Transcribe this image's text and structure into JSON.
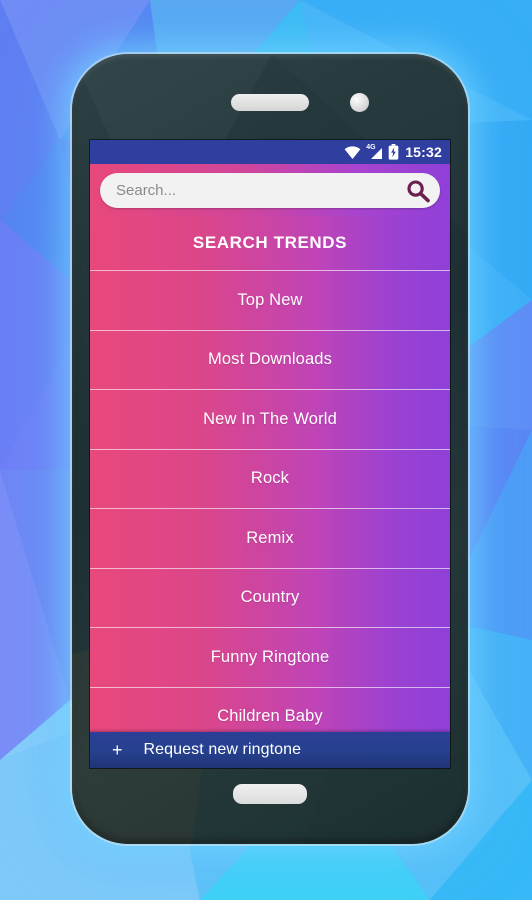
{
  "wallpaper": {
    "style": "low-poly-triangles",
    "base_color": "#3fa9f5"
  },
  "device": {
    "frame_color": "#23373b",
    "speaker_name": "earpiece-speaker",
    "camera_name": "front-camera",
    "home_button_name": "home-button"
  },
  "status_bar": {
    "background": "#303f9f",
    "time": "15:32",
    "network_label": "4G",
    "icons": [
      "wifi-icon",
      "signal-icon",
      "battery-charging-icon"
    ]
  },
  "search": {
    "value": "",
    "placeholder": "Search...",
    "icon": "search-icon",
    "icon_color": "#6b1f4e",
    "field_background": "#f2f2f2"
  },
  "theme": {
    "gradient_start": "#e8487b",
    "gradient_end": "#8f3fd8",
    "divider": "rgba(255,255,255,0.62)",
    "text_color": "#ffffff",
    "accent_bar": "#26418f"
  },
  "list": {
    "header": "SEARCH TRENDS",
    "items": [
      {
        "label": "Top New"
      },
      {
        "label": "Most Downloads"
      },
      {
        "label": "New In The World"
      },
      {
        "label": "Rock"
      },
      {
        "label": "Remix"
      },
      {
        "label": "Country"
      },
      {
        "label": "Funny Ringtone"
      },
      {
        "label": "Children Baby"
      }
    ]
  },
  "request_bar": {
    "plus": "+",
    "label": "Request new ringtone",
    "background": "#26418f"
  }
}
